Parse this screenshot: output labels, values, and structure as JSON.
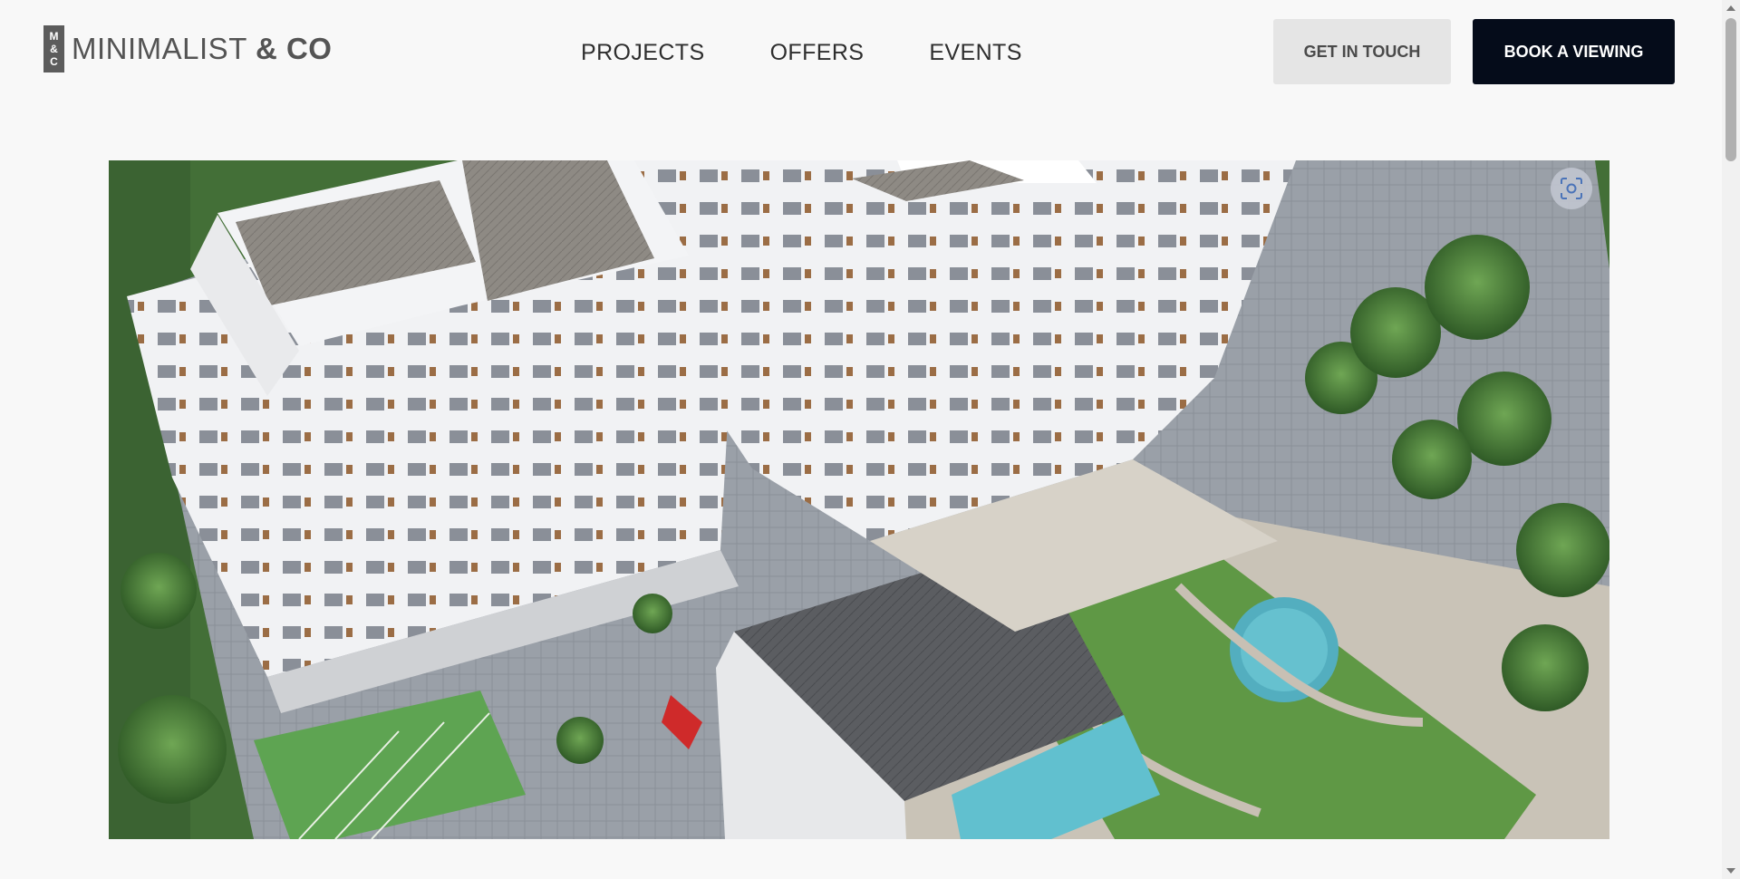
{
  "brand": {
    "mark_top": "M",
    "mark_mid": "&",
    "mark_bottom": "C",
    "name_light": "MINIMALIST",
    "name_bold": "& CO"
  },
  "nav": {
    "items": [
      "PROJECTS",
      "OFFERS",
      "EVENTS"
    ]
  },
  "actions": {
    "get_in_touch": "GET IN TOUCH",
    "book_viewing": "BOOK A VIEWING"
  },
  "hero": {
    "icon": "visual-search-icon"
  },
  "colors": {
    "primary_button": "#050c1a",
    "secondary_button": "#e5e5e5",
    "page_background": "#f8f8f8"
  }
}
